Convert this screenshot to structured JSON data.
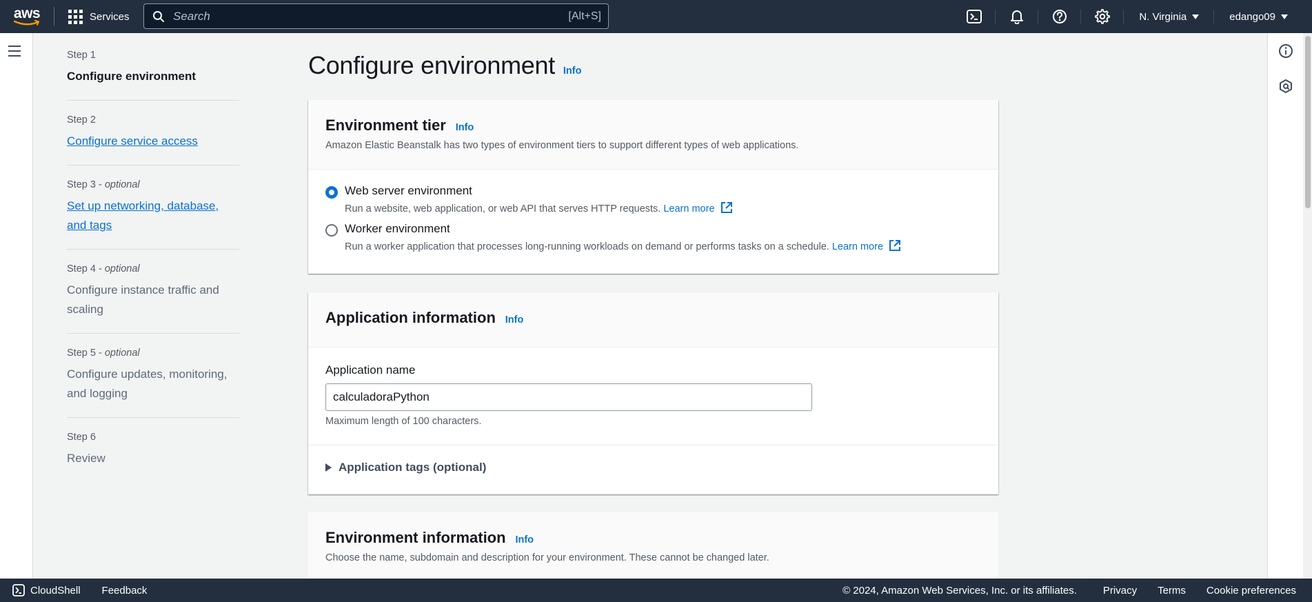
{
  "topnav": {
    "logo_text": "aws",
    "services_label": "Services",
    "search_placeholder": "Search",
    "search_shortcut": "[Alt+S]",
    "region": "N. Virginia",
    "user": "edango09"
  },
  "steps": [
    {
      "num": "Step 1",
      "optional": "",
      "title": "Configure environment",
      "state": "current"
    },
    {
      "num": "Step 2",
      "optional": "",
      "title": "Configure service access",
      "state": "link"
    },
    {
      "num": "Step 3 - ",
      "optional": "optional",
      "title": "Set up networking, database, and tags",
      "state": "link"
    },
    {
      "num": "Step 4 - ",
      "optional": "optional",
      "title": "Configure instance traffic and scaling",
      "state": "disabled"
    },
    {
      "num": "Step 5 - ",
      "optional": "optional",
      "title": "Configure updates, monitoring, and logging",
      "state": "disabled"
    },
    {
      "num": "Step 6",
      "optional": "",
      "title": "Review",
      "state": "disabled"
    }
  ],
  "page": {
    "title": "Configure environment",
    "info": "Info"
  },
  "env_tier": {
    "title": "Environment tier",
    "info": "Info",
    "description": "Amazon Elastic Beanstalk has two types of environment tiers to support different types of web applications.",
    "options": [
      {
        "label": "Web server environment",
        "sub": "Run a website, web application, or web API that serves HTTP requests.",
        "learn_more": "Learn more",
        "selected": true
      },
      {
        "label": "Worker environment",
        "sub": "Run a worker application that processes long-running workloads on demand or performs tasks on a schedule.",
        "learn_more": "Learn more",
        "selected": false
      }
    ]
  },
  "app_info": {
    "title": "Application information",
    "info": "Info",
    "name_label": "Application name",
    "name_value": "calculadoraPython",
    "name_hint": "Maximum length of 100 characters.",
    "tags_label": "Application tags (optional)"
  },
  "env_info": {
    "title": "Environment information",
    "info": "Info",
    "description": "Choose the name, subdomain and description for your environment. These cannot be changed later."
  },
  "footer": {
    "cloudshell": "CloudShell",
    "feedback": "Feedback",
    "copyright": "© 2024, Amazon Web Services, Inc. or its affiliates.",
    "privacy": "Privacy",
    "terms": "Terms",
    "cookies": "Cookie preferences"
  },
  "colors": {
    "nav_bg": "#232f3e",
    "link": "#0972d3",
    "aws_orange": "#ff9900"
  }
}
